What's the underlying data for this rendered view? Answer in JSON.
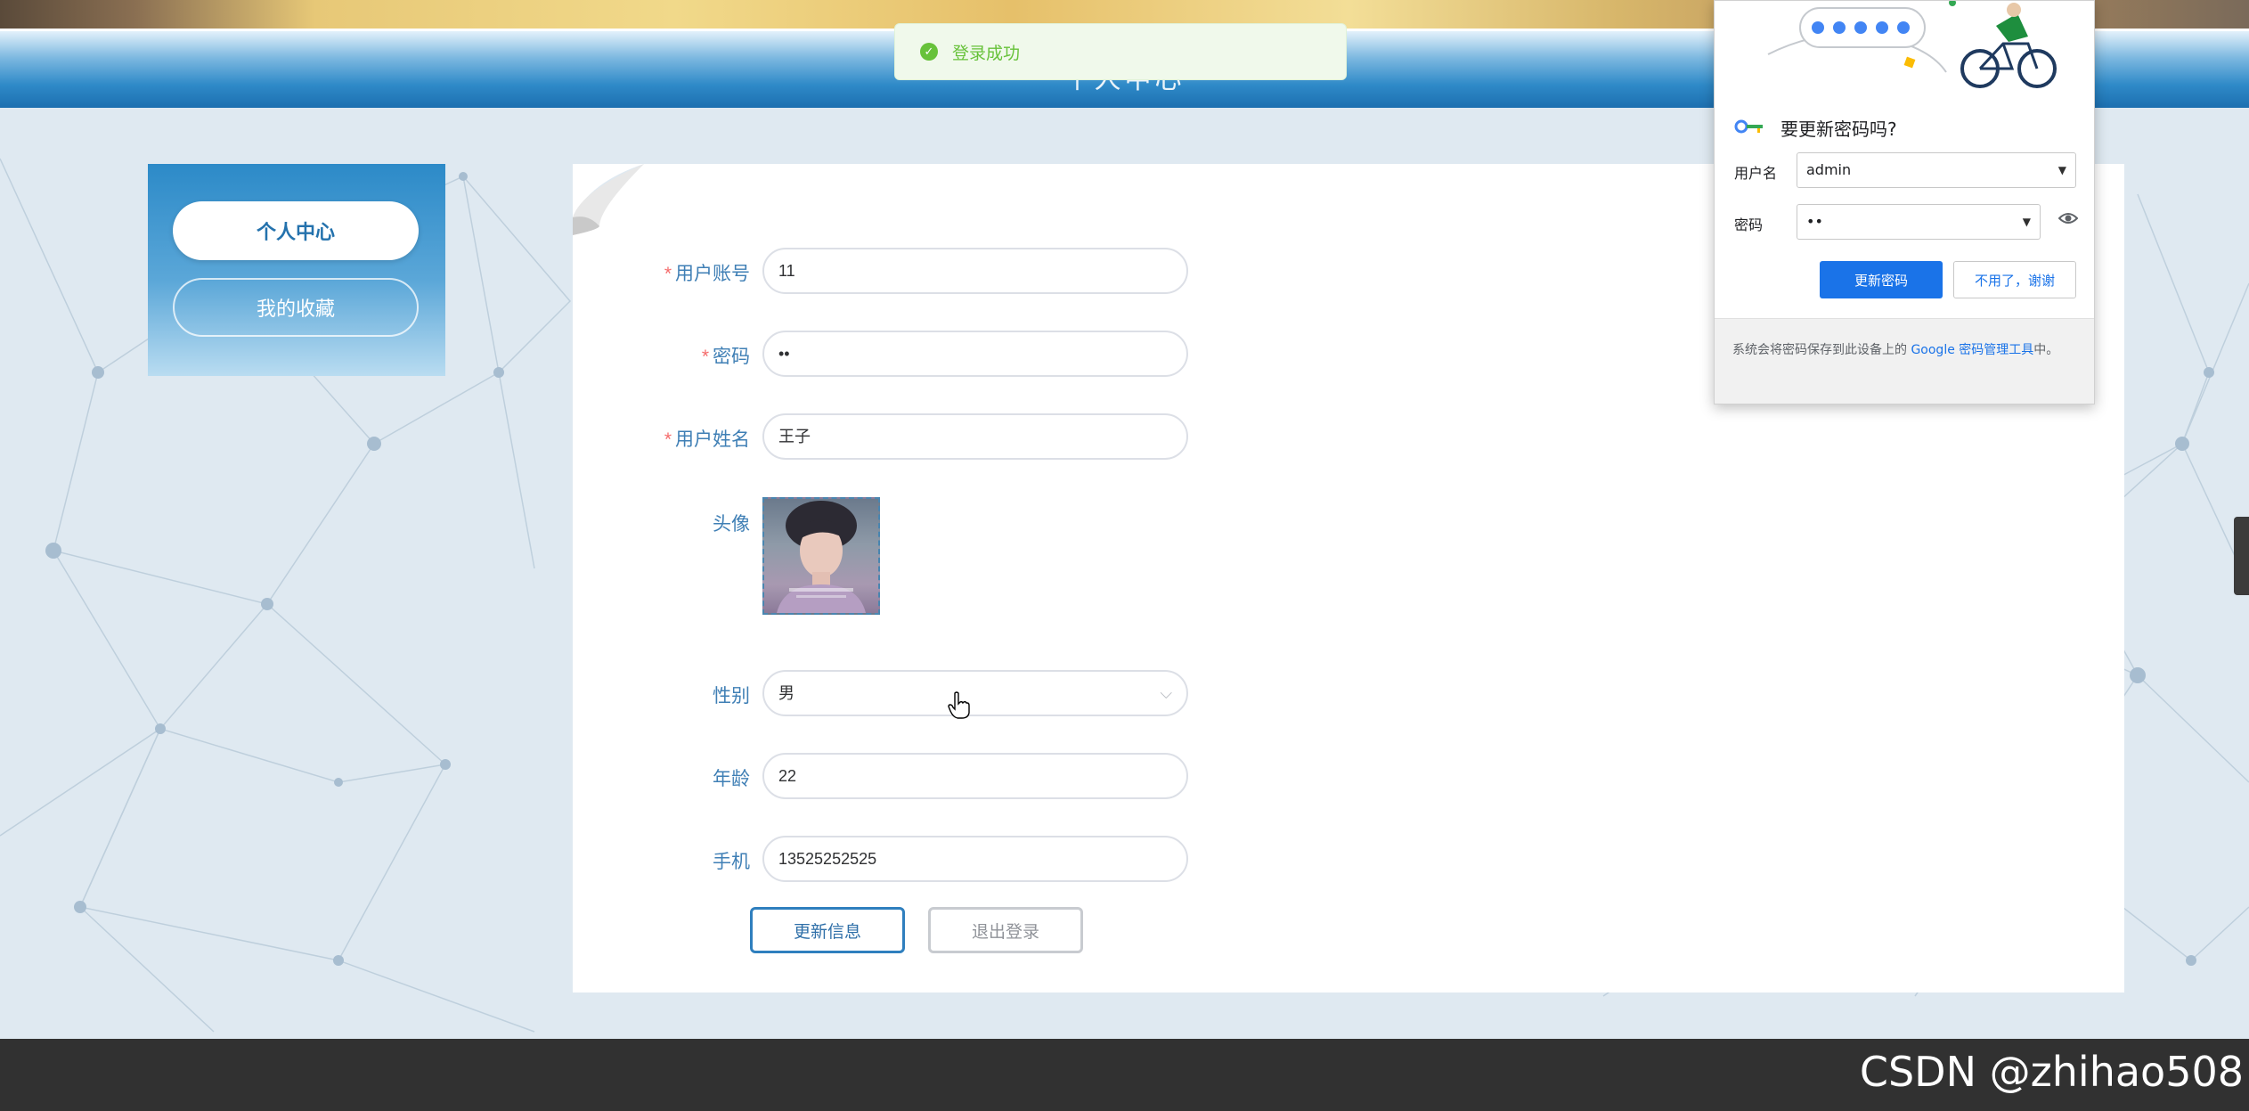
{
  "header": {
    "title": "个人中心"
  },
  "toast": {
    "message": "登录成功"
  },
  "sidebar": {
    "items": [
      {
        "label": "个人中心"
      },
      {
        "label": "我的收藏"
      }
    ]
  },
  "form": {
    "fields": {
      "account": {
        "label": "用户账号",
        "value": "11"
      },
      "password": {
        "label": "密码",
        "value": "••"
      },
      "name": {
        "label": "用户姓名",
        "value": "王子"
      },
      "avatar": {
        "label": "头像"
      },
      "gender": {
        "label": "性别",
        "value": "男"
      },
      "age": {
        "label": "年龄",
        "value": "22"
      },
      "phone": {
        "label": "手机",
        "value": "13525252525"
      }
    },
    "required_mark": "*",
    "buttons": {
      "update": "更新信息",
      "logout": "退出登录"
    }
  },
  "password_popup": {
    "title": "要更新密码吗?",
    "username_label": "用户名",
    "username_value": "admin",
    "password_label": "密码",
    "password_value": "••",
    "update_button": "更新密码",
    "decline_button": "不用了，谢谢",
    "footer_prefix": "系统会将密码保存到此设备上的 ",
    "footer_link": "Google 密码管理工具",
    "footer_suffix": "中。"
  },
  "watermark": "CSDN @zhihao508",
  "colors": {
    "accent": "#2f7fbe",
    "label": "#3f7fb5",
    "required": "#f56c6c",
    "success": "#67c23a",
    "google_blue": "#1a73e8"
  }
}
